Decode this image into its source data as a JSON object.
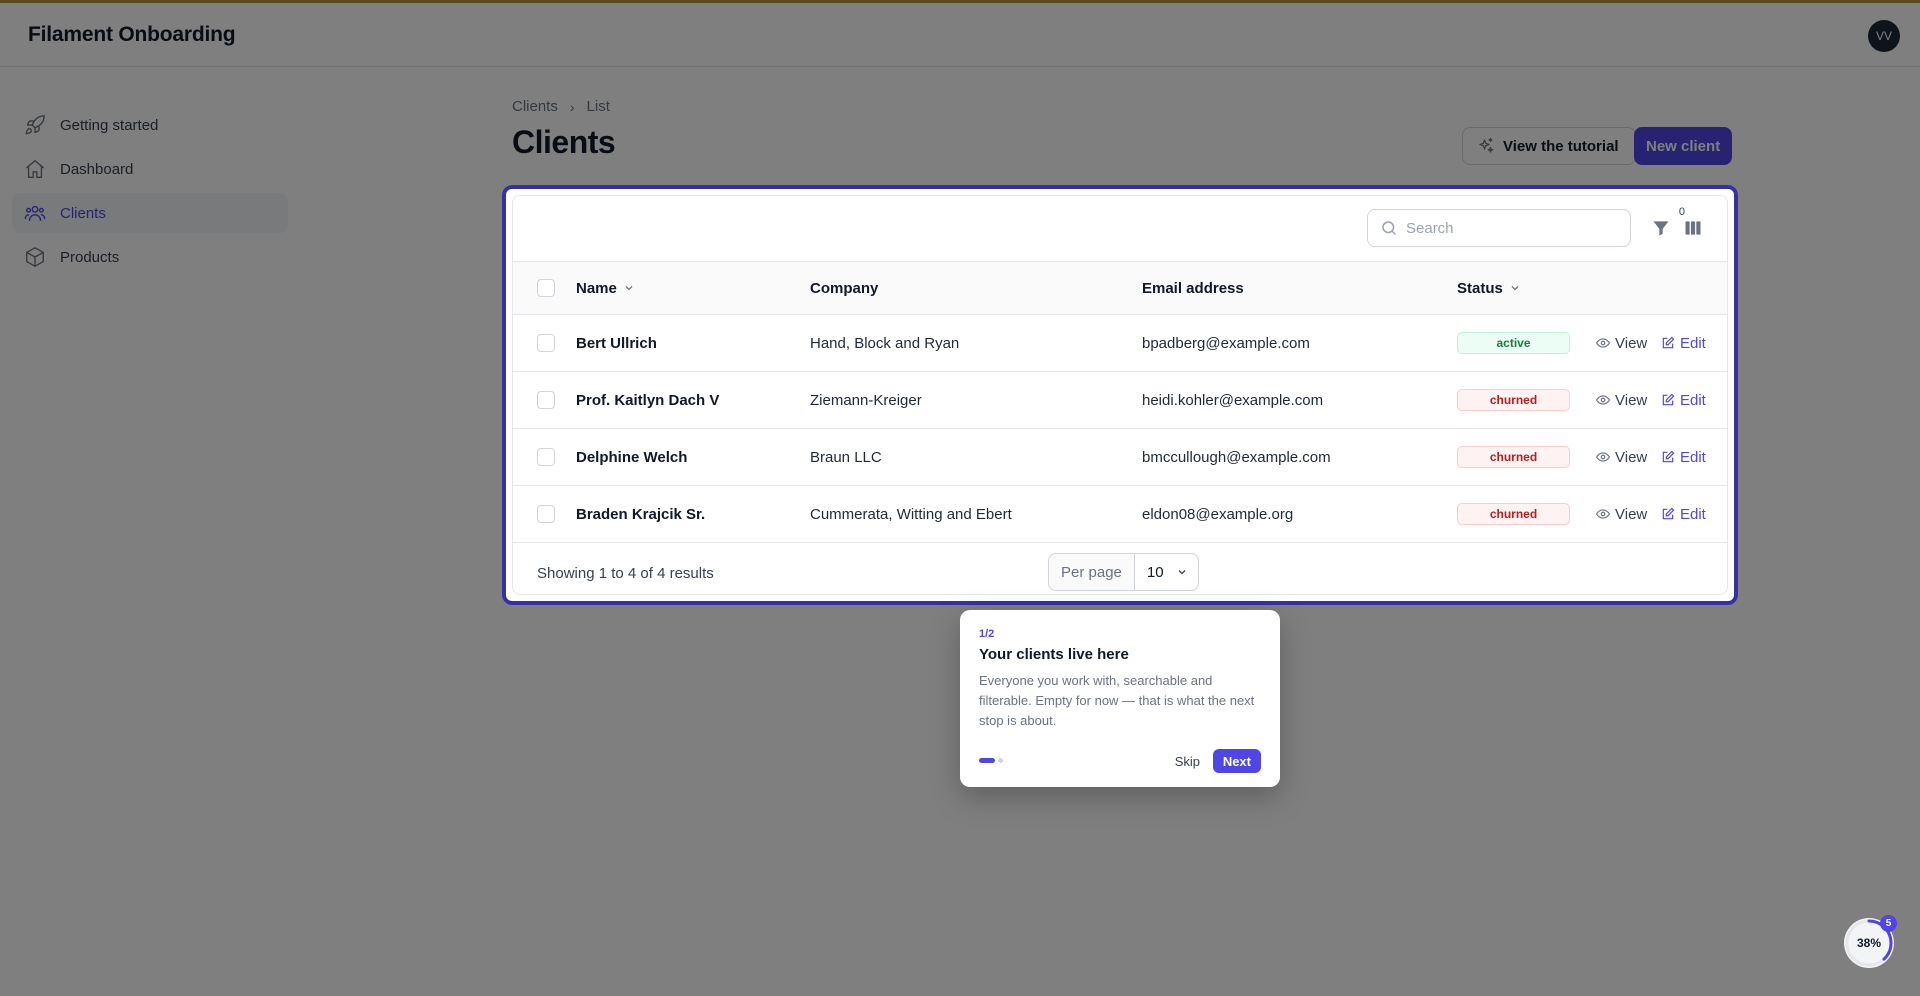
{
  "app": {
    "title": "Filament Onboarding",
    "user_initials": "VV"
  },
  "sidebar": {
    "items": [
      {
        "label": "Getting started",
        "icon": "rocket-icon",
        "active": false
      },
      {
        "label": "Dashboard",
        "icon": "home-icon",
        "active": false
      },
      {
        "label": "Clients",
        "icon": "users-icon",
        "active": true
      },
      {
        "label": "Products",
        "icon": "cube-icon",
        "active": false
      }
    ]
  },
  "breadcrumb": {
    "root": "Clients",
    "current": "List"
  },
  "page": {
    "title": "Clients"
  },
  "header_actions": {
    "tutorial_label": "View the tutorial",
    "new_label": "New client"
  },
  "table": {
    "search_placeholder": "Search",
    "filter_count": "0",
    "columns": {
      "name": "Name",
      "company": "Company",
      "email": "Email address",
      "status": "Status"
    },
    "rows": [
      {
        "name": "Bert Ullrich",
        "company": "Hand, Block and Ryan",
        "email": "bpadberg@example.com",
        "status": "active"
      },
      {
        "name": "Prof. Kaitlyn Dach V",
        "company": "Ziemann-Kreiger",
        "email": "heidi.kohler@example.com",
        "status": "churned"
      },
      {
        "name": "Delphine Welch",
        "company": "Braun LLC",
        "email": "bmccullough@example.com",
        "status": "churned"
      },
      {
        "name": "Braden Krajcik Sr.",
        "company": "Cummerata, Witting and Ebert",
        "email": "eldon08@example.org",
        "status": "churned"
      }
    ],
    "row_actions": {
      "view": "View",
      "edit": "Edit"
    },
    "footer": {
      "showing": "Showing 1 to 4 of 4 results",
      "per_page_label": "Per page",
      "per_page_value": "10"
    }
  },
  "tour": {
    "step": "1/2",
    "title": "Your clients live here",
    "body": "Everyone you work with, searchable and filterable. Empty for now — that is what the next stop is about.",
    "skip_label": "Skip",
    "next_label": "Next"
  },
  "progress": {
    "percent_label": "38%",
    "percent": 38,
    "count": "5"
  },
  "colors": {
    "accent": "#4f46e5",
    "highlight_border": "#3730a3",
    "active_badge": "#15803d",
    "churned_badge": "#b91c1c"
  }
}
